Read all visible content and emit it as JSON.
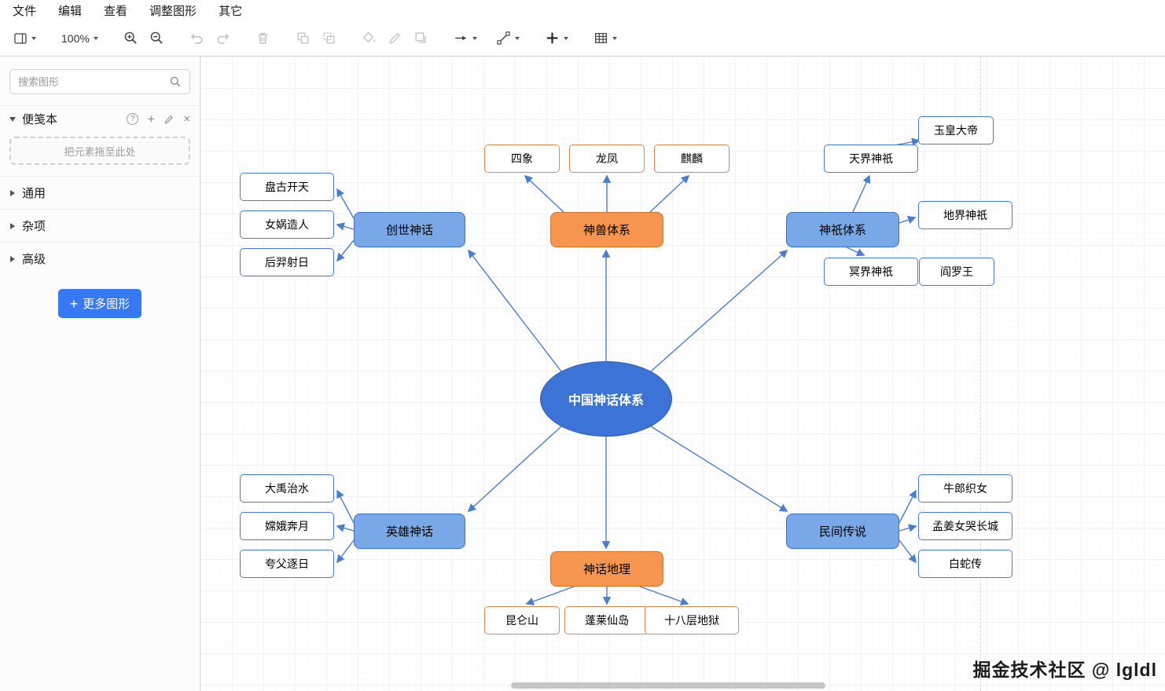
{
  "menubar": {
    "items": [
      "文件",
      "编辑",
      "查看",
      "调整图形",
      "其它"
    ]
  },
  "toolbar": {
    "zoom": "100%"
  },
  "sidebar": {
    "search_placeholder": "搜索图形",
    "scratchpad_title": "便笺本",
    "drop_hint": "把元素拖至此处",
    "sections": [
      {
        "label": "通用"
      },
      {
        "label": "杂项"
      },
      {
        "label": "高级"
      }
    ],
    "more_shapes_label": "更多图形"
  },
  "diagram": {
    "center": {
      "label": "中国神话体系"
    },
    "branches": [
      {
        "label": "创世神话"
      },
      {
        "label": "神兽体系"
      },
      {
        "label": "神祇体系"
      },
      {
        "label": "英雄神话"
      },
      {
        "label": "神话地理"
      },
      {
        "label": "民间传说"
      }
    ],
    "leaves": [
      {
        "label": "盘古开天"
      },
      {
        "label": "女娲造人"
      },
      {
        "label": "后羿射日"
      },
      {
        "label": "四象"
      },
      {
        "label": "龙凤"
      },
      {
        "label": "麒麟"
      },
      {
        "label": "天界神祇"
      },
      {
        "label": "玉皇大帝"
      },
      {
        "label": "地界神祇"
      },
      {
        "label": "冥界神祇"
      },
      {
        "label": "阎罗王"
      },
      {
        "label": "大禹治水"
      },
      {
        "label": "嫦娥奔月"
      },
      {
        "label": "夸父逐日"
      },
      {
        "label": "昆仑山"
      },
      {
        "label": "蓬莱仙岛"
      },
      {
        "label": "十八层地狱"
      },
      {
        "label": "牛郎织女"
      },
      {
        "label": "孟姜女哭长城"
      },
      {
        "label": "白蛇传"
      }
    ],
    "watermark": "掘金技术社区 @ lgldl"
  },
  "colors": {
    "center_fill": "#3b74d6",
    "branch_blue_fill": "#79a8e8",
    "branch_orange_fill": "#f59550",
    "edge": "#4a7cd0",
    "more_shapes_button": "#3579f6"
  }
}
